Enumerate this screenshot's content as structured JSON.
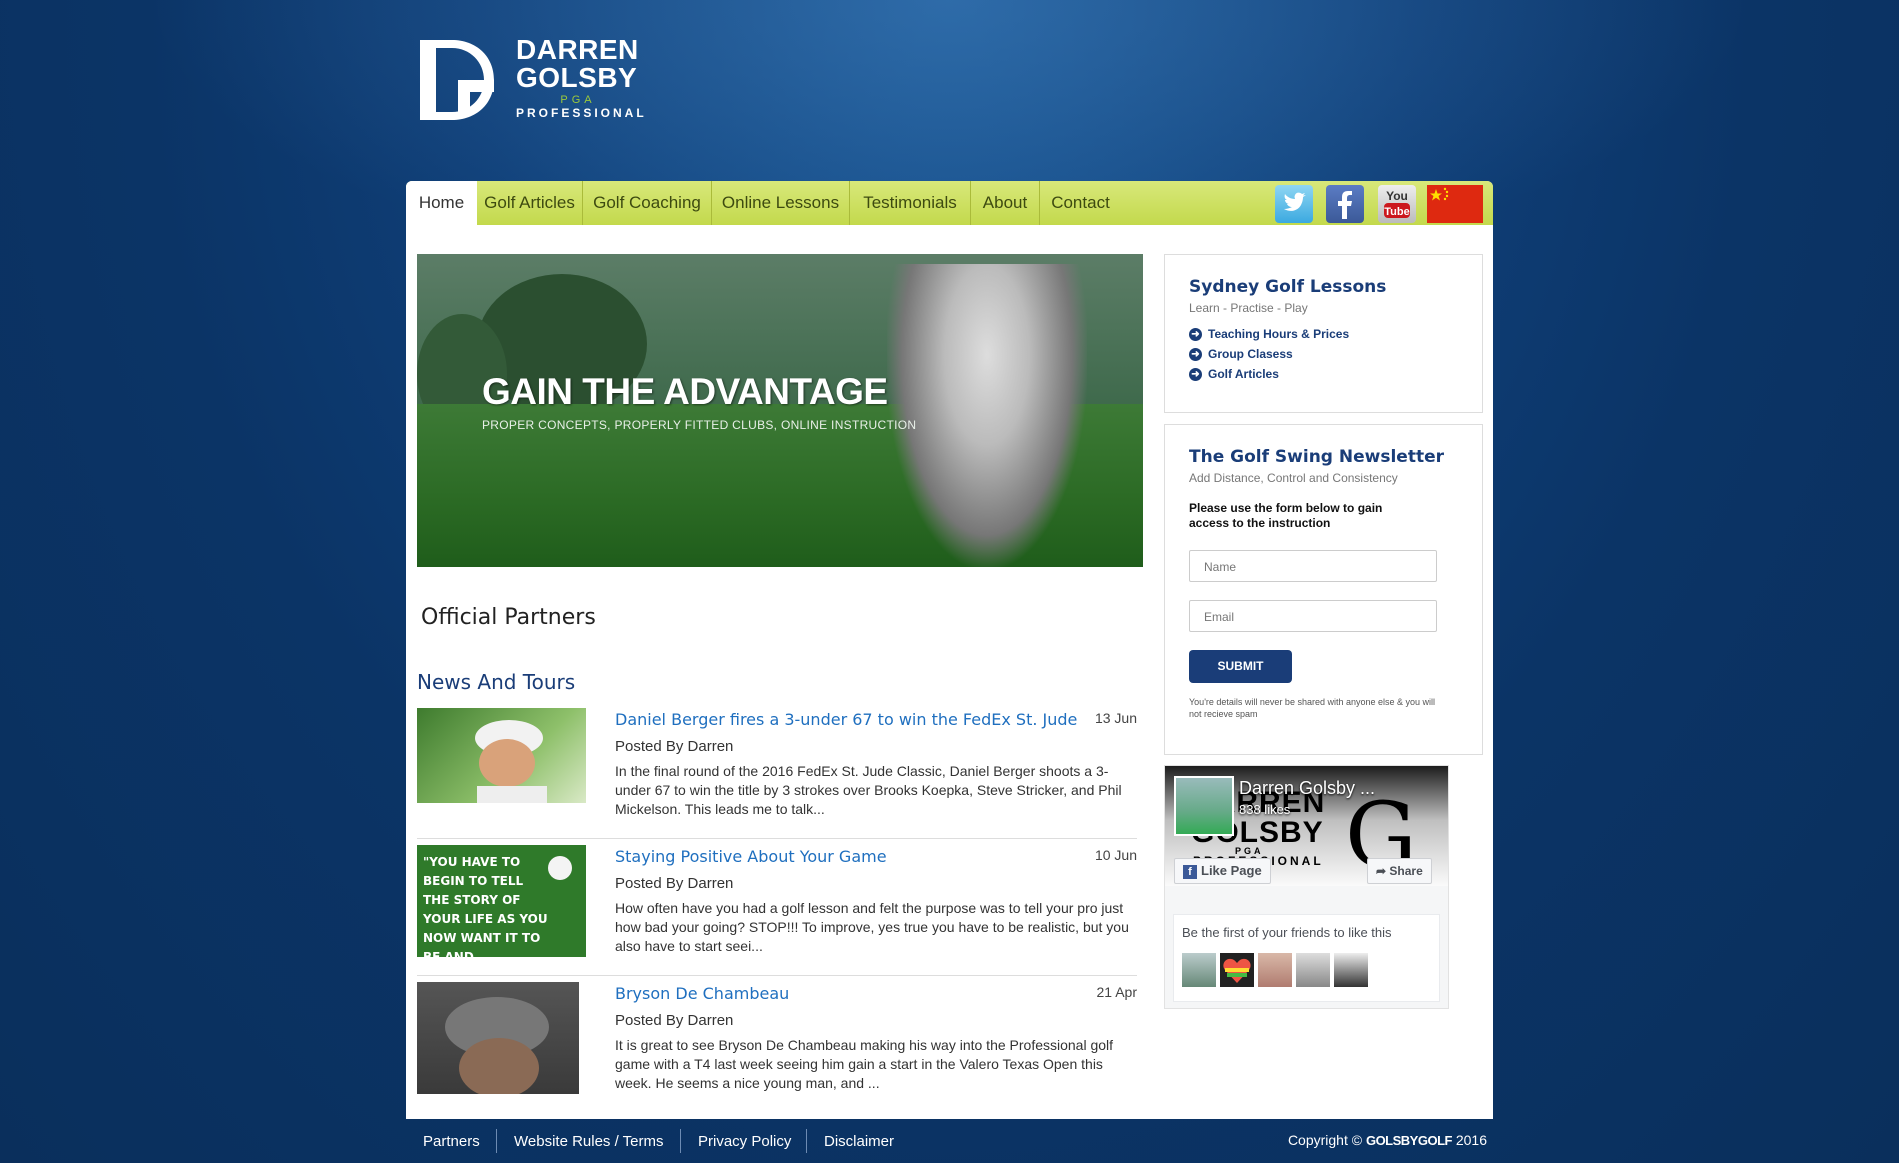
{
  "logo": {
    "line1": "DARREN",
    "line2": "GOLSBY",
    "pga": "PGA",
    "pro": "PROFESSIONAL"
  },
  "nav": [
    "Home",
    "Golf Articles",
    "Golf Coaching",
    "Online Lessons",
    "Testimonials",
    "About",
    "Contact"
  ],
  "social": [
    "twitter-icon",
    "facebook-icon",
    "youtube-icon",
    "china-flag-icon"
  ],
  "colors": {
    "brand_blue": "#1a3d78",
    "nav_green": "#c3d94c",
    "link_blue": "#1f6fbf"
  },
  "hero": {
    "title": "GAIN THE ADVANTAGE",
    "subtitle": "PROPER CONCEPTS, PROPERLY FITTED CLUBS, ONLINE INSTRUCTION"
  },
  "partners": {
    "title": "Official Partners"
  },
  "news": {
    "title": "News And Tours",
    "items": [
      {
        "title": "Daniel Berger fires a 3-under 67 to win the FedEx St. Jude",
        "date": "13 Jun",
        "author": "Posted By Darren",
        "excerpt": "In the final round of the 2016 FedEx St. Jude Classic, Daniel Berger shoots a 3-under 67 to win the title by 3 strokes over Brooks Koepka, Steve Stricker, and Phil Mickelson. This leads me to talk..."
      },
      {
        "title": "Staying Positive About Your Game",
        "date": "10 Jun",
        "author": "Posted By Darren",
        "excerpt": "How often have you had a golf lesson and felt the purpose was to tell your pro just how bad your going? STOP!!! To improve, yes true you have to be realistic, but you also have to start seei..."
      },
      {
        "title": "Bryson De Chambeau",
        "date": "21 Apr",
        "author": "Posted By Darren",
        "excerpt": "It is great to see Bryson De Chambeau making his way into the Professional golf game with a T4 last week seeing him gain a start in the Valero Texas Open this week. He seems a nice young man, and ..."
      }
    ],
    "thumb2_text": "\"YOU HAVE TO BEGIN TO TELL THE STORY OF YOUR LIFE AS YOU NOW WANT IT TO BE AND DISCONTINUE THE TALES OF HOW IT HAS"
  },
  "lessons_box": {
    "title": "Sydney Golf Lessons",
    "subtitle": "Learn - Practise - Play",
    "links": [
      "Teaching Hours & Prices",
      "Group Clasess",
      "Golf Articles"
    ]
  },
  "newsletter": {
    "title": "The Golf Swing Newsletter",
    "subtitle": "Add Distance, Control and Consistency",
    "instruction": "Please use the form below to gain access to the instruction",
    "name_placeholder": "Name",
    "email_placeholder": "Email",
    "submit": "SUBMIT",
    "disclaimer": "You're details will never be shared with anyone else & you will not recieve spam"
  },
  "facebook": {
    "name": "Darren Golsby ...",
    "likes": "838 likes",
    "cover_line1": "DARREN",
    "cover_line2": "GOLSBY",
    "cover_pga": "PGA",
    "cover_pro": "PROFESSIONAL",
    "like_page": "Like Page",
    "share": "Share",
    "friends_text": "Be the first of your friends to like this"
  },
  "footer": {
    "links": [
      "Partners",
      "Website Rules / Terms",
      "Privacy Policy",
      "Disclaimer"
    ],
    "copyright_prefix": "Copyright ©",
    "copyright_brand": "GOLSBYGOLF",
    "copyright_year": "2016"
  }
}
